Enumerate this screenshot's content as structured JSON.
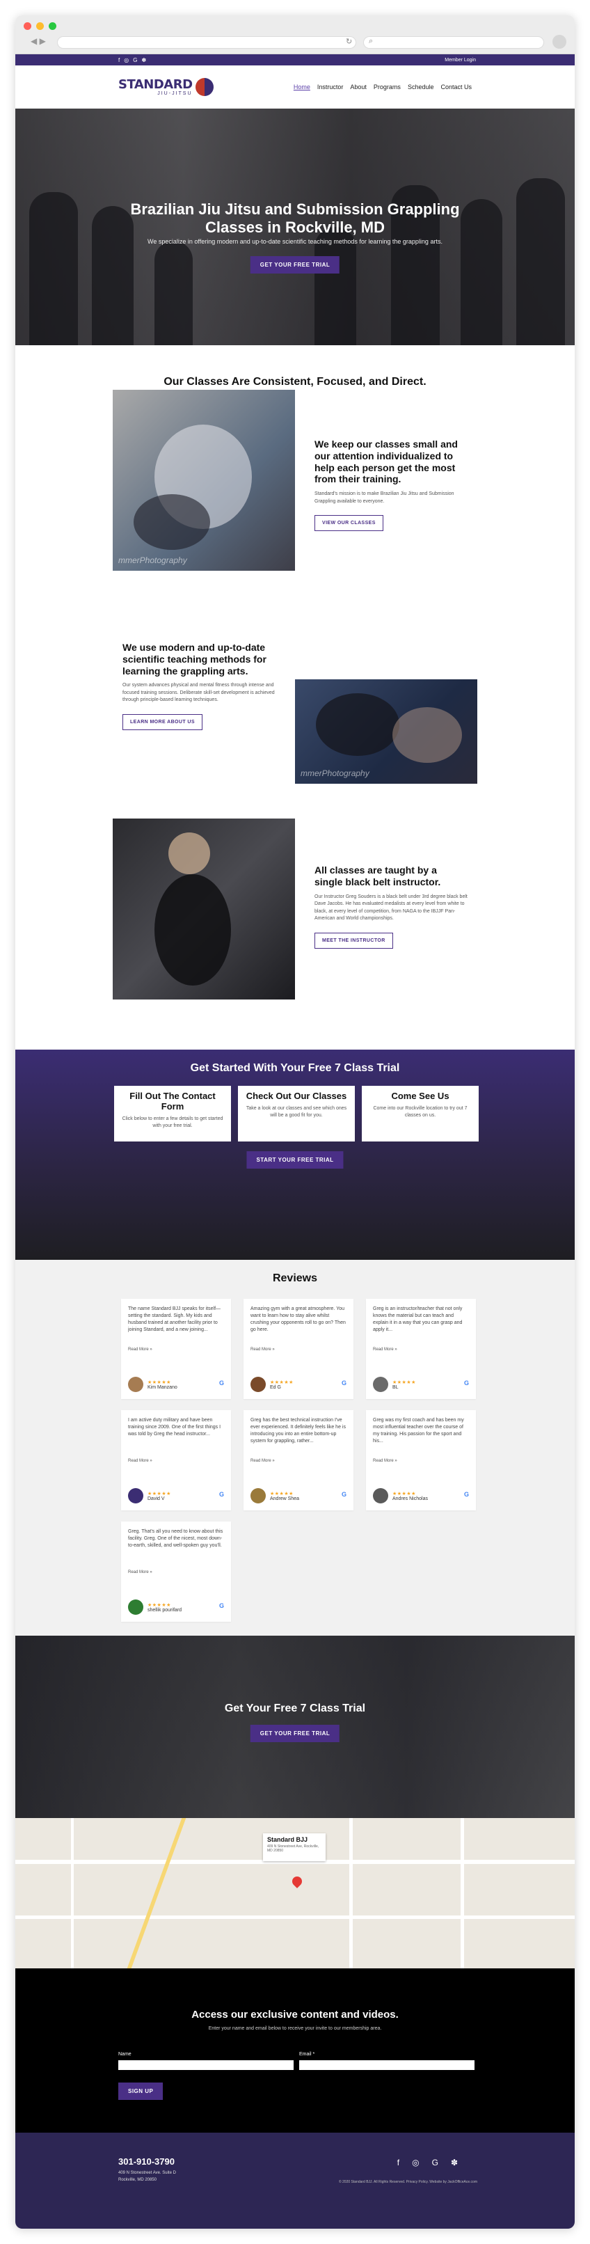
{
  "topbar": {
    "socials": [
      "f",
      "◎",
      "G",
      "✽"
    ],
    "login": "Member Login"
  },
  "header": {
    "logo_word": "STANDARD",
    "logo_sub": "JIU-JITSU",
    "nav": [
      "Home",
      "Instructor",
      "About",
      "Programs",
      "Schedule",
      "Contact Us"
    ]
  },
  "hero": {
    "title": "Brazilian Jiu Jitsu and Submission Grappling Classes in Rockville, MD",
    "subtitle": "We specialize in offering modern and up-to-date scientific teaching methods for learning the grappling arts.",
    "button": "GET YOUR FREE TRIAL"
  },
  "classes": {
    "title": "Our Classes Are Consistent, Focused, and Direct.",
    "items": [
      {
        "heading": "We keep our classes small and our attention individualized to help each person get the most from their training.",
        "text": "Standard's mission is to make Brazilian Jiu Jitsu and Submission Grappling available to everyone.",
        "button": "VIEW OUR CLASSES"
      },
      {
        "heading": "We use modern and up-to-date scientific teaching methods for learning the grappling arts.",
        "text": "Our system advances physical and mental fitness through intense and focused training sessions. Deliberate skill-set development is achieved through principle-based learning techniques.",
        "button": "LEARN MORE ABOUT US"
      },
      {
        "heading": "All classes are taught by a single black belt instructor.",
        "text": "Our Instructor Greg Souders is a black belt under 3rd degree black belt Dave Jacobs. He has evaluated medalists at every level from white to black, at every level of competition, from NAGA to the IBJJF Pan-American and World championships.",
        "button": "MEET THE INSTRUCTOR"
      }
    ],
    "watermark": "mmerPhotography"
  },
  "trial": {
    "title": "Get Started With Your Free 7 Class Trial",
    "cards": [
      {
        "title": "Fill Out The Contact Form",
        "text": "Click below to enter a few details to get started with your free trial."
      },
      {
        "title": "Check Out Our Classes",
        "text": "Take a look at our classes and see which ones will be a good fit for you."
      },
      {
        "title": "Come See Us",
        "text": "Come into our Rockville location to try out 7 classes on us."
      }
    ],
    "button": "START YOUR FREE TRIAL"
  },
  "reviews": {
    "title": "Reviews",
    "read_more": "Read More »",
    "stars": "★★★★★",
    "items": [
      {
        "text": "The name Standard BJJ speaks for itself—setting the standard. Sigh. My kids and husband trained at another facility prior to joining Standard, and a new joining...",
        "name": "Kim Manzano",
        "color": "#a67c52"
      },
      {
        "text": "Amazing gym with a great atmosphere. You want to learn how to stay alive whilst crushing your opponents roll to go on? Then go here.",
        "name": "Ed G",
        "color": "#7a4a2a"
      },
      {
        "text": "Greg is an instructor/teacher that not only knows the material but can teach and explain it in a way that you can grasp and apply it...",
        "name": "BL",
        "color": "#6a6a6a"
      },
      {
        "text": "I am active duty military and have been training since 2009. One of the first things I was told by Greg the head instructor...",
        "name": "David V",
        "color": "#3b2d73"
      },
      {
        "text": "Greg has the best technical instruction I've ever experienced. It definitely feels like he is introducing you into an entire bottom-up system for grappling, rather...",
        "name": "Andrew Shea",
        "color": "#9a7a3a"
      },
      {
        "text": "Greg was my first coach and has been my most influential teacher over the course of my training. His passion for the sport and his...",
        "name": "Andres Nicholas",
        "color": "#5a5a5a"
      },
      {
        "text": "Greg. That's all you need to know about this facility. Greg. One of the nicest, most down-to-earth, skilled, and well-spoken guy you'll.",
        "name": "shellik pourifard",
        "color": "#2e7d32"
      }
    ]
  },
  "cta2": {
    "title": "Get Your Free 7 Class Trial",
    "button": "GET YOUR FREE TRIAL"
  },
  "map": {
    "title": "Standard BJJ",
    "address": "409 N Stonestreet Ave, Rockville, MD 20850"
  },
  "access": {
    "title": "Access our exclusive content and videos.",
    "subtitle": "Enter your name and email below to receive your invite to our membership area.",
    "name_label": "Name",
    "email_label": "Email *",
    "button": "SIGN UP"
  },
  "footer": {
    "phone": "301-910-3790",
    "address1": "409 N Stonestreet Ave. Suite D",
    "address2": "Rockville, MD 20850",
    "icons": [
      "f",
      "◎",
      "G",
      "✽"
    ],
    "copyright": "© 2020 Standard BJJ. All Rights Reserved. Privacy Policy. Website by JackOfficeAce.com"
  }
}
